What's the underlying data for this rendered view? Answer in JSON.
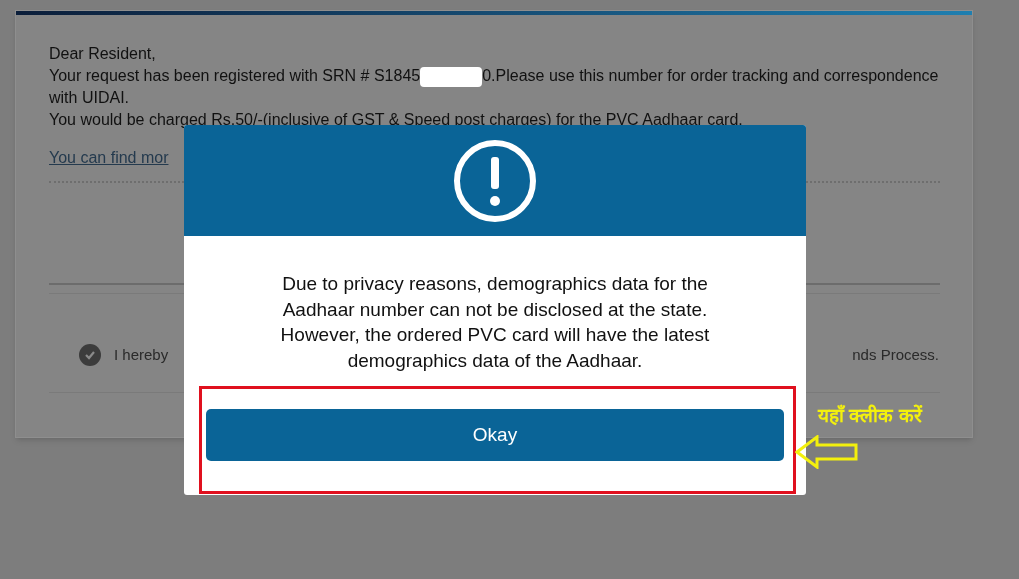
{
  "page": {
    "greeting": "Dear Resident,",
    "srn_before": "Your request has been registered with SRN # S1845",
    "srn_after": "0.Please use this number for order tracking and correspondence with UIDAI.",
    "charge_note": "You would be charged Rs.50/-(inclusive of GST & Speed post charges) for the PVC Aadhaar card.",
    "link": "You can find mor",
    "consent": {
      "checked": true,
      "text_start": "I hereby",
      "text_end": "nds Process."
    }
  },
  "dialog": {
    "message": "Due to privacy reasons, demographics data for the Aadhaar number can not be disclosed at the state. However, the ordered PVC card will have the latest demographics data of the Aadhaar.",
    "button": "Okay"
  },
  "annotation": {
    "label": "यहाँ क्लीक करें"
  }
}
